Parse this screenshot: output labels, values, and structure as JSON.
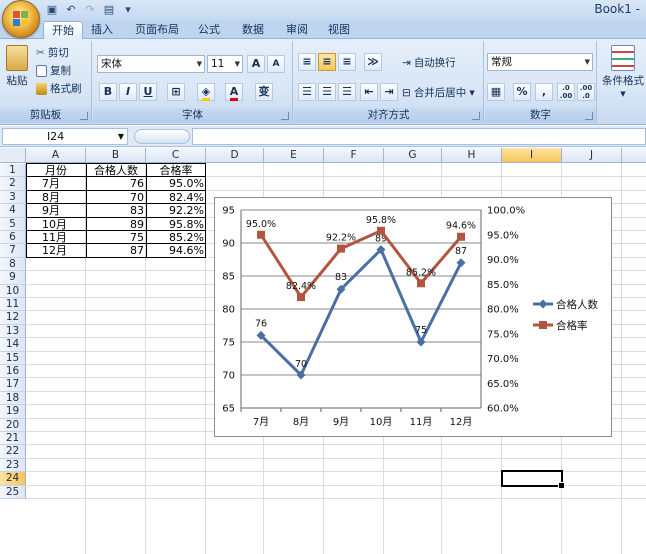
{
  "app": {
    "title": "Book1 -"
  },
  "quick_access": [
    {
      "name": "save-icon",
      "glyph": "▣"
    },
    {
      "name": "undo-icon",
      "glyph": "↶"
    },
    {
      "name": "redo-icon",
      "glyph": "↷"
    },
    {
      "name": "print-preview-icon",
      "glyph": "▤"
    },
    {
      "name": "customize-icon",
      "glyph": "▾"
    }
  ],
  "tabs": [
    "开始",
    "插入",
    "页面布局",
    "公式",
    "数据",
    "审阅",
    "视图"
  ],
  "ribbon": {
    "clipboard": {
      "label": "剪贴板",
      "paste": "粘贴",
      "cut": "剪切",
      "copy": "复制",
      "format_painter": "格式刷"
    },
    "font": {
      "label": "字体",
      "name": "宋体",
      "size": "11",
      "grow": "A",
      "shrink": "A",
      "bold": "B",
      "italic": "I",
      "underline": "U",
      "pinyin": "变"
    },
    "alignment": {
      "label": "对齐方式",
      "wrap": "自动换行",
      "merge": "合并后居中"
    },
    "number": {
      "label": "数字",
      "format": "常规",
      "percent": "%",
      "comma": ",",
      "inc_dec": ".0\n.00",
      "dec_dec": ".00\n.0"
    },
    "styles": {
      "conditional": "条件格式"
    }
  },
  "formula_bar": {
    "name_box": "I24",
    "formula": ""
  },
  "grid": {
    "columns": [
      "A",
      "B",
      "C",
      "D",
      "E",
      "F",
      "G",
      "H",
      "I",
      "J"
    ],
    "selected_column": "I",
    "selected_row": "24",
    "rows": [
      "1",
      "2",
      "3",
      "4",
      "5",
      "6",
      "7",
      "8",
      "9",
      "10",
      "11",
      "12",
      "13",
      "14",
      "15",
      "16",
      "17",
      "18",
      "19",
      "20",
      "21",
      "22",
      "23",
      "24",
      "25"
    ],
    "header": [
      "月份",
      "合格人数",
      "合格率"
    ],
    "data": [
      [
        "7月",
        "76",
        "95.0%"
      ],
      [
        "8月",
        "70",
        "82.4%"
      ],
      [
        "9月",
        "83",
        "92.2%"
      ],
      [
        "10月",
        "89",
        "95.8%"
      ],
      [
        "11月",
        "75",
        "85.2%"
      ],
      [
        "12月",
        "87",
        "94.6%"
      ]
    ]
  },
  "chart_data": {
    "type": "line",
    "categories": [
      "7月",
      "8月",
      "9月",
      "10月",
      "11月",
      "12月"
    ],
    "series": [
      {
        "name": "合格人数",
        "axis": "left",
        "values": [
          76,
          70,
          83,
          89,
          75,
          87
        ],
        "labels": [
          "76",
          "70",
          "83",
          "89",
          "75",
          "87"
        ],
        "color": "#4a6fa5",
        "marker": "diamond"
      },
      {
        "name": "合格率",
        "axis": "right",
        "values": [
          0.95,
          0.824,
          0.922,
          0.958,
          0.852,
          0.946
        ],
        "labels": [
          "95.0%",
          "82.4%",
          "92.2%",
          "95.8%",
          "85.2%",
          "94.6%"
        ],
        "color": "#b0553f",
        "marker": "square"
      }
    ],
    "left_axis": {
      "min": 65,
      "max": 95,
      "ticks": [
        "65",
        "70",
        "75",
        "80",
        "85",
        "90",
        "95"
      ]
    },
    "right_axis": {
      "min": 0.6,
      "max": 1.0,
      "ticks": [
        "60.0%",
        "65.0%",
        "70.0%",
        "75.0%",
        "80.0%",
        "85.0%",
        "90.0%",
        "95.0%",
        "100.0%"
      ]
    },
    "grid": true,
    "legend": "right"
  }
}
